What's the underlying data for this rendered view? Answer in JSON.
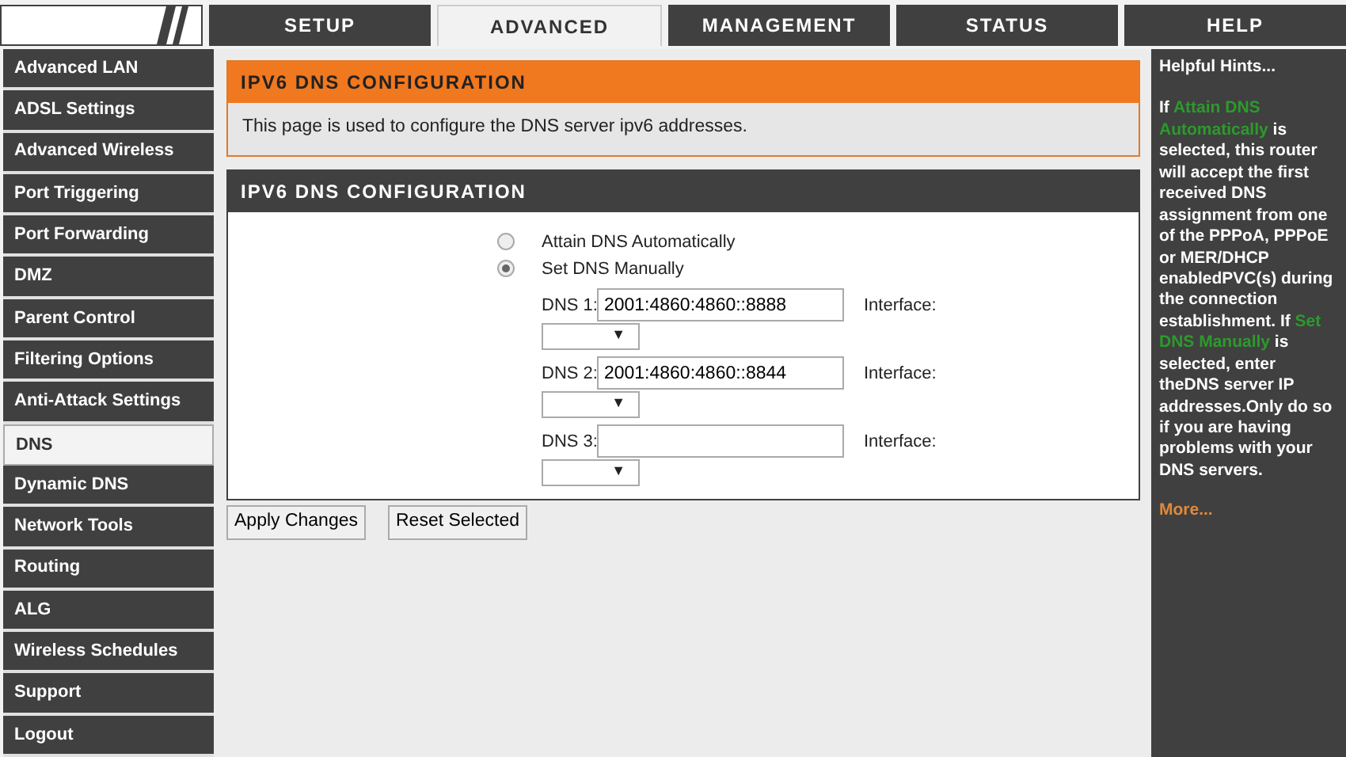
{
  "tabs": [
    {
      "label": "SETUP",
      "selected": false
    },
    {
      "label": "ADVANCED",
      "selected": true
    },
    {
      "label": "MANAGEMENT",
      "selected": false
    },
    {
      "label": "STATUS",
      "selected": false
    },
    {
      "label": "HELP",
      "selected": false
    }
  ],
  "sidebar": {
    "items": [
      {
        "label": "Advanced LAN",
        "selected": false
      },
      {
        "label": "ADSL Settings",
        "selected": false
      },
      {
        "label": "Advanced Wireless",
        "selected": false
      },
      {
        "label": "Port Triggering",
        "selected": false
      },
      {
        "label": "Port Forwarding",
        "selected": false
      },
      {
        "label": "DMZ",
        "selected": false
      },
      {
        "label": "Parent Control",
        "selected": false
      },
      {
        "label": "Filtering Options",
        "selected": false
      },
      {
        "label": "Anti-Attack Settings",
        "selected": false
      },
      {
        "label": "DNS",
        "selected": true
      },
      {
        "label": "Dynamic DNS",
        "selected": false
      },
      {
        "label": "Network Tools",
        "selected": false
      },
      {
        "label": "Routing",
        "selected": false
      },
      {
        "label": "ALG",
        "selected": false
      },
      {
        "label": "Wireless Schedules",
        "selected": false
      },
      {
        "label": "Support",
        "selected": false
      },
      {
        "label": "Logout",
        "selected": false
      }
    ]
  },
  "intro": {
    "title": "IPV6 DNS CONFIGURATION",
    "text": "This page is used to configure the DNS server ipv6 addresses."
  },
  "config": {
    "title": "IPV6 DNS CONFIGURATION",
    "modes": [
      {
        "label": "Attain DNS Automatically",
        "selected": false
      },
      {
        "label": "Set DNS Manually",
        "selected": true
      }
    ],
    "servers": [
      {
        "label": "DNS 1:",
        "value": "2001:4860:4860::8888",
        "interface_label": "Interface:",
        "arrow": "▼"
      },
      {
        "label": "DNS 2:",
        "value": "2001:4860:4860::8844",
        "interface_label": "Interface:",
        "arrow": "▼"
      },
      {
        "label": "DNS 3:",
        "interface_label": "Interface:",
        "arrow": "▼"
      }
    ]
  },
  "buttons": [
    "Apply Changes",
    "Reset Selected"
  ],
  "hints": {
    "title": "Helpful Hints...",
    "parts": [
      {
        "kind": "text",
        "text": "If "
      },
      {
        "kind": "term",
        "text": "Attain DNS Automatically"
      },
      {
        "kind": "text",
        "text": " is selected, this router will accept the first received DNS assignment from one of the PPPoA, PPPoE or MER/DHCP enabledPVC(s) during the connection establishment. If "
      },
      {
        "kind": "term",
        "text": "Set DNS Manually"
      },
      {
        "kind": "text",
        "text": " is selected, enter theDNS server IP addresses.Only do so if you are having problems with your DNS servers."
      }
    ],
    "more": "More..."
  }
}
